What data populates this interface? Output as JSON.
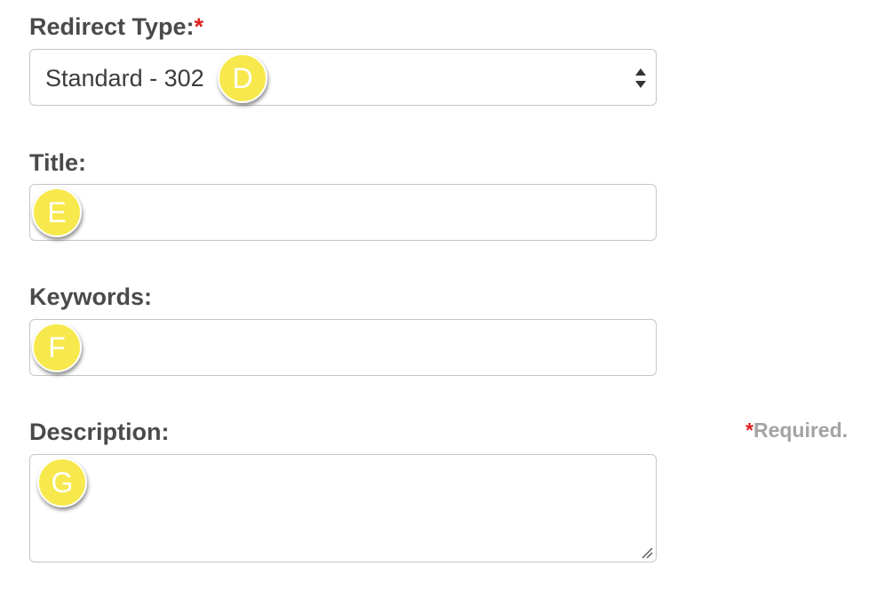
{
  "form": {
    "redirect_type": {
      "label": "Redirect Type:",
      "required_marker": "*",
      "value": "Standard - 302"
    },
    "title": {
      "label": "Title:",
      "value": ""
    },
    "keywords": {
      "label": "Keywords:",
      "value": ""
    },
    "description": {
      "label": "Description:",
      "value": ""
    },
    "required_note": {
      "star": "*",
      "text": "Required."
    }
  },
  "markers": {
    "d": "D",
    "e": "E",
    "f": "F",
    "g": "G"
  },
  "colors": {
    "marker_fill": "#f7e94d",
    "required_star": "#e02020",
    "label_text": "#4a4a4a",
    "note_text": "#a3a3a3"
  }
}
